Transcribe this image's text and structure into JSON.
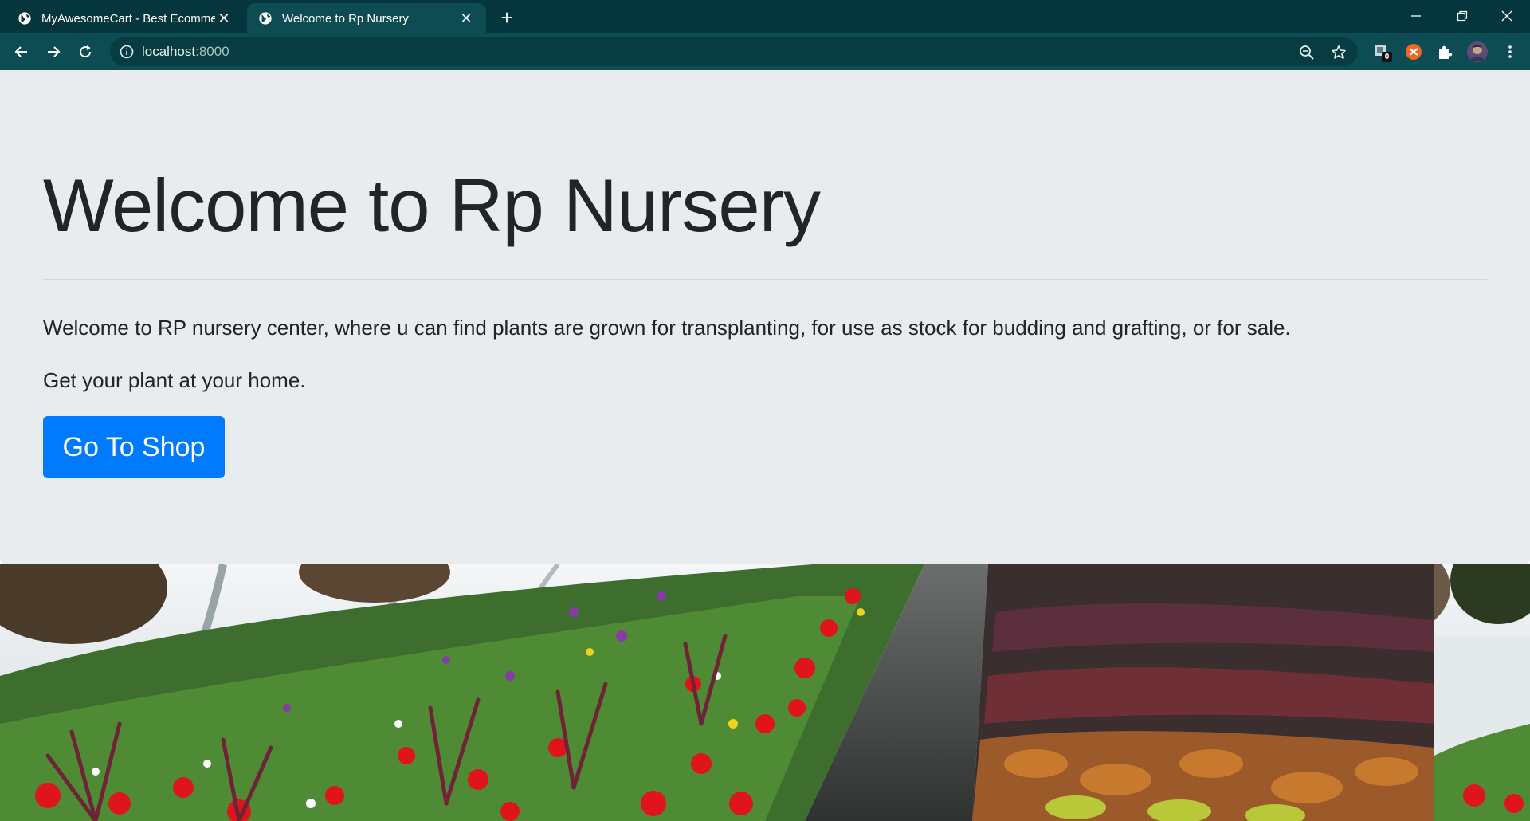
{
  "browser": {
    "tabs": [
      {
        "title": "MyAwesomeCart - Best Ecommerce",
        "icon": "globe-icon",
        "active": false
      },
      {
        "title": "Welcome to Rp Nursery",
        "icon": "globe-icon",
        "active": true
      }
    ],
    "url_host": "localhost",
    "url_port": ":8000",
    "extension_badge": "0",
    "colors": {
      "frame": "#06363d",
      "toolbar": "#0d4c53",
      "omnibox": "#073c42"
    }
  },
  "page": {
    "heading": "Welcome to Rp Nursery",
    "intro": "Welcome to RP nursery center, where u can find plants are grown for transplanting, for use as stock for budding and grafting, or for sale.",
    "tagline": "Get your plant at your home.",
    "shop_button": "Go To Shop",
    "colors": {
      "jumbotron": "#e9ecef",
      "button": "#007bff",
      "text": "#212529"
    }
  },
  "hero_image": {
    "subject": "greenhouse-flowers-photo"
  }
}
